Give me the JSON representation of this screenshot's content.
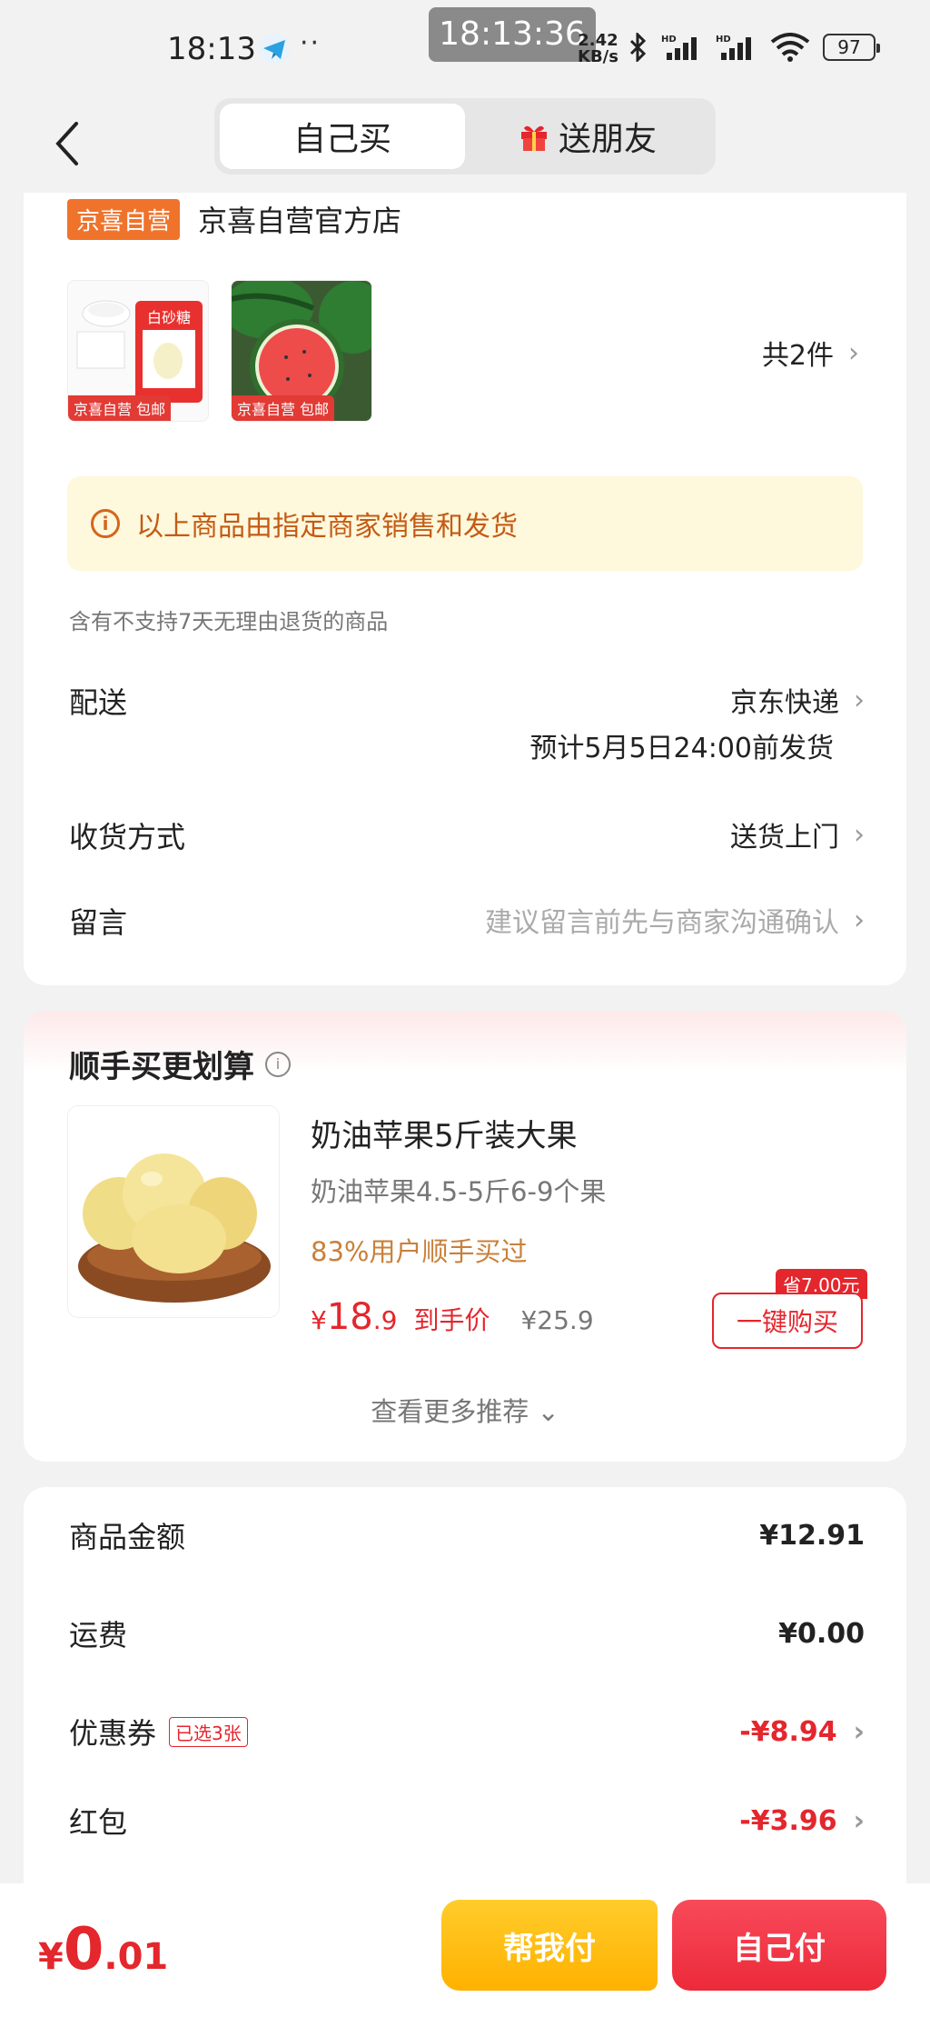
{
  "status_bar": {
    "time": "18:13",
    "overlay_time": "18:13:36",
    "speed_value": "2.42",
    "speed_unit": "KB/s",
    "battery": "97"
  },
  "header": {
    "tab_self": "自己买",
    "tab_gift": "送朋友"
  },
  "order": {
    "shop_badge": "京喜自营",
    "shop_name": "京喜自营官方店",
    "item_count": "共2件",
    "thumb_tag": "京喜自营 包邮",
    "thumb1_label": "白砂糖",
    "notice": "以上商品由指定商家销售和发货",
    "return_note": "含有不支持7天无理由退货的商品",
    "delivery_label": "配送",
    "delivery_value": "京东快递",
    "delivery_sub": "预计5月5日24:00前发货",
    "receive_label": "收货方式",
    "receive_value": "送货上门",
    "message_label": "留言",
    "message_placeholder": "建议留言前先与商家沟通确认"
  },
  "recommend": {
    "title": "顺手买更划算",
    "name": "奶油苹果5斤装大果",
    "spec": "奶油苹果4.5-5斤6-9个果",
    "social": "83%用户顺手买过",
    "price_yen": "¥",
    "price_int": "18",
    "price_dec": ".9",
    "price_label": "到手价",
    "price_orig": "¥25.9",
    "save_tag": "省7.00元",
    "buy_button": "一键购买",
    "more": "查看更多推荐"
  },
  "summary": {
    "goods_label": "商品金额",
    "goods_value": "¥12.91",
    "freight_label": "运费",
    "freight_value": "¥0.00",
    "coupon_label": "优惠券",
    "coupon_tag": "已选3张",
    "coupon_value": "-¥8.94",
    "redpack_label": "红包",
    "redpack_value": "-¥3.96"
  },
  "bottom": {
    "total_yen": "¥",
    "total_int": "0",
    "total_dec": ".01",
    "help_pay": "帮我付",
    "self_pay": "自己付"
  },
  "colors": {
    "accent_red": "#e4262d",
    "accent_yellow": "#ffb100",
    "shop_orange": "#f0732c",
    "notice_bg": "#fef8dc"
  }
}
